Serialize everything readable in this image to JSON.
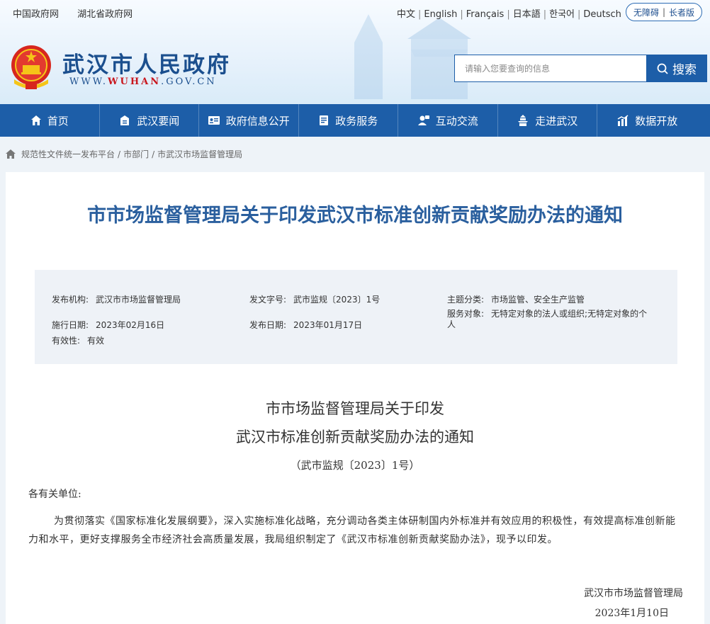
{
  "top_links": [
    "中国政府网",
    "湖北省政府网"
  ],
  "languages": [
    "中文",
    "English",
    "Français",
    "日本語",
    "한국어",
    "Deutsch"
  ],
  "accessibility": {
    "barrier_free": "无障碍",
    "elder": "长者版"
  },
  "site": {
    "name": "武汉市人民政府",
    "url_prefix": "WWW.",
    "url_mid": "WUHAN",
    "url_suffix": ".GOV.CN"
  },
  "search": {
    "placeholder": "请输入您要查询的信息",
    "button": "搜索"
  },
  "nav": [
    {
      "label": "首页",
      "icon": "home-icon"
    },
    {
      "label": "武汉要闻",
      "icon": "news-icon"
    },
    {
      "label": "政府信息公开",
      "icon": "info-card-icon"
    },
    {
      "label": "政务服务",
      "icon": "service-icon"
    },
    {
      "label": "互动交流",
      "icon": "chat-user-icon"
    },
    {
      "label": "走进武汉",
      "icon": "tower-icon"
    },
    {
      "label": "数据开放",
      "icon": "chart-icon"
    }
  ],
  "breadcrumb": [
    "规范性文件统一发布平台",
    "市部门",
    "市武汉市场监督管理局"
  ],
  "article": {
    "title": "市市场监督管理局关于印发武汉市标准创新贡献奖励办法的通知",
    "meta": {
      "publisher_key": "发布机构:",
      "publisher": "武汉市市场监督管理局",
      "doc_no_key": "发文字号:",
      "doc_no": "武市监规〔2023〕1号",
      "topic_key": "主题分类:",
      "topic": "市场监管、安全生产监管",
      "target_key": "服务对象:",
      "target": "无特定对象的法人或组织;无特定对象的个人",
      "effective_date_key": "施行日期:",
      "effective_date": "2023年02月16日",
      "publish_date_key": "发布日期:",
      "publish_date": "2023年01月17日",
      "validity_key": "有效性:",
      "validity": "有效"
    },
    "doc_title_line1": "市市场监督管理局关于印发",
    "doc_title_line2": "武汉市标准创新贡献奖励办法的通知",
    "doc_number": "（武市监规〔2023〕1号）",
    "greeting": "各有关单位:",
    "paragraph": "为贯彻落实《国家标准化发展纲要》，深入实施标准化战略，充分调动各类主体研制国内外标准并有效应用的积极性，有效提高标准创新能力和水平，更好支撑服务全市经济社会高质量发展，我局组织制定了《武汉市标准创新贡献奖励办法》，现予以印发。",
    "signature": "武汉市市场监督管理局",
    "sign_date": "2023年1月10日"
  }
}
